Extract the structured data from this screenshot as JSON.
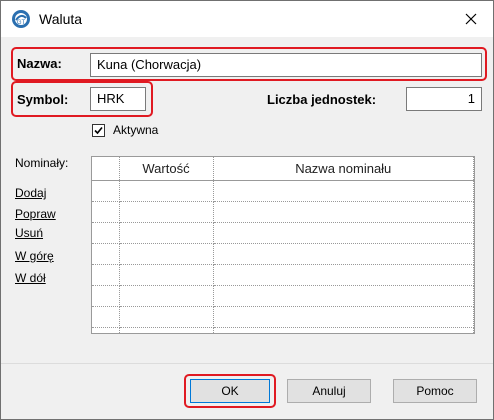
{
  "window": {
    "title": "Waluta",
    "close_icon": "close-icon",
    "app_icon": "app-logo-icon"
  },
  "form": {
    "nazwa_label": "Nazwa:",
    "nazwa_value": "Kuna (Chorwacja)",
    "symbol_label": "Symbol:",
    "symbol_value": "HRK",
    "liczba_label": "Liczba jednostek:",
    "liczba_value": "1",
    "aktywna_label": "Aktywna",
    "aktywna_checked": true
  },
  "nominaly": {
    "label": "Nominały:",
    "actions": [
      "Dodaj",
      "Popraw",
      "Usuń",
      "W górę",
      "W dół"
    ],
    "columns": [
      "",
      "Wartość",
      "Nazwa nominału"
    ],
    "rows": [
      [
        "",
        "",
        ""
      ],
      [
        "",
        "",
        ""
      ],
      [
        "",
        "",
        ""
      ],
      [
        "",
        "",
        ""
      ],
      [
        "",
        "",
        ""
      ],
      [
        "",
        "",
        ""
      ],
      [
        "",
        "",
        ""
      ],
      [
        "",
        "",
        ""
      ]
    ]
  },
  "buttons": {
    "ok": "OK",
    "cancel": "Anuluj",
    "help": "Pomoc"
  },
  "colors": {
    "highlight": "#e01a22",
    "accent": "#0078d7"
  }
}
